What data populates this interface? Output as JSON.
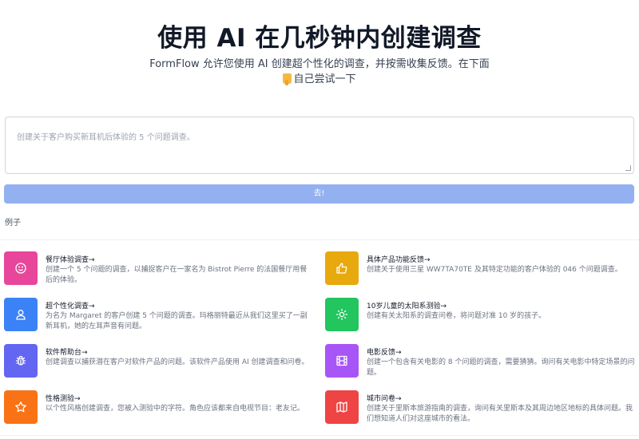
{
  "hero": {
    "title": "使用 AI 在几秒钟内创建调查",
    "subtitle_line1": "FormFlow 允许您使用 AI 创建超个性化的调查，并按需收集反馈。在下面",
    "subtitle_line2": "自己尝试一下"
  },
  "prompt": {
    "placeholder": "创建关于客户购买新耳机后体验的 5 个问题调查。"
  },
  "go_button": {
    "label": "去!"
  },
  "examples": {
    "label": "例子",
    "items": [
      {
        "title": "餐厅体验调查→",
        "desc": "创建一个 5 个问题的调查，以捕捉客户在一家名为 Bistrot Pierre 的法国餐厅用餐后的体验。",
        "icon": "smile-icon",
        "color": "#e8469a"
      },
      {
        "title": "具体产品功能反馈→",
        "desc": "创建关于使用三星 WW7TA70TE 及其特定功能的客户体验的 046 个问题调查。",
        "icon": "thumbs-up-icon",
        "color": "#e8a90e"
      },
      {
        "title": "超个性化调查→",
        "desc": "为名为 Margaret 的客户创建 5 个问题的调查。玛格丽特最近从我们这里买了一副新耳机，她的左耳声音有问题。",
        "icon": "user-icon",
        "color": "#3b82f6"
      },
      {
        "title": "10岁儿童的太阳系测验→",
        "desc": "创建有关太阳系的调查问卷，将问题对准 10 岁的孩子。",
        "icon": "sun-icon",
        "color": "#22c55e"
      },
      {
        "title": "软件帮助台→",
        "desc": "创建调查以捕获潜在客户对软件产品的问题。该软件产品使用 AI 创建调查和问卷。",
        "icon": "bug-icon",
        "color": "#6366f1"
      },
      {
        "title": "电影反馈→",
        "desc": "创建一个包含有关电影的 8 个问题的调查，需要猜猜。询问有关电影中特定场景的问题。",
        "icon": "film-icon",
        "color": "#a855f7"
      },
      {
        "title": "性格测验→",
        "desc": "以个性风格创建调查，您被入测验中的字符。角色应该都来自电视节目：老友记。",
        "icon": "star-icon",
        "color": "#f97316"
      },
      {
        "title": "城市问卷→",
        "desc": "创建关于里斯本旅游指南的调查，询问有关里斯本及其周边地区地标的具体问题。我们想知道人们对这座城市的看法。",
        "icon": "map-icon",
        "color": "#ef4444"
      }
    ]
  }
}
